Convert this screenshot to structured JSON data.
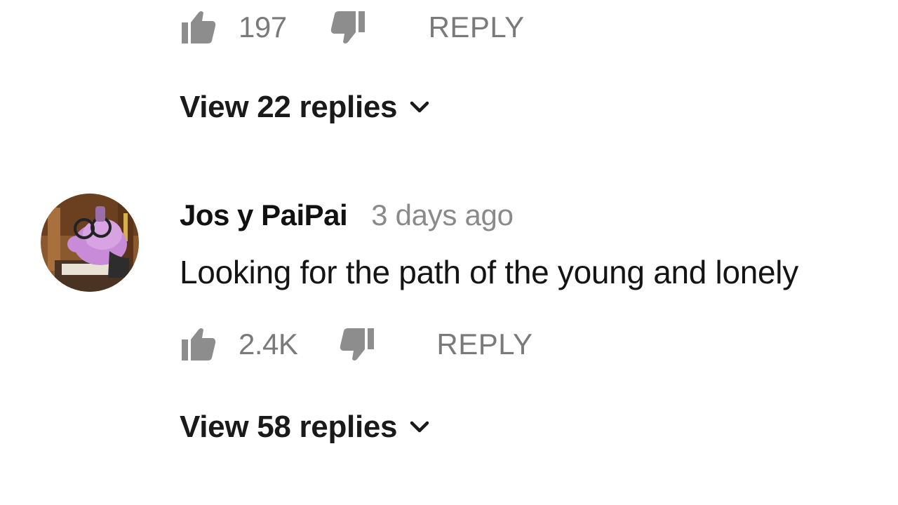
{
  "prev_comment": {
    "like_count": "197",
    "reply_label": "REPLY",
    "view_replies": "View 22 replies"
  },
  "comment": {
    "author": "Jos y PaiPai",
    "time": "3 days ago",
    "text": "Looking for the path of the young and lonely",
    "like_count": "2.4K",
    "reply_label": "REPLY",
    "view_replies": "View 58 replies"
  },
  "icons": {
    "like": "thumbs-up-icon",
    "dislike": "thumbs-down-icon",
    "expand": "chevron-down-icon"
  },
  "colors": {
    "icon_gray": "#8d8d8d",
    "secondary_text": "#7a7a7a",
    "primary_text": "#111111"
  }
}
